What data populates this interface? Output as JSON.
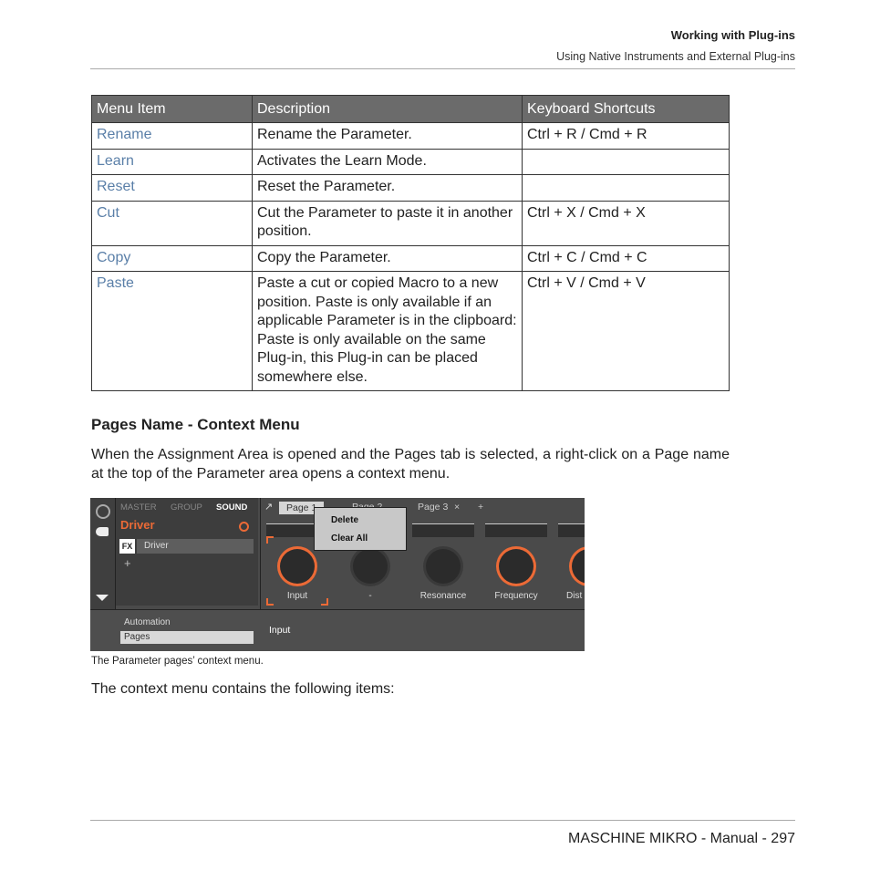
{
  "header": {
    "title": "Working with Plug-ins",
    "subtitle": "Using Native Instruments and External Plug-ins"
  },
  "table": {
    "headers": [
      "Menu Item",
      "Description",
      "Keyboard Shortcuts"
    ],
    "rows": [
      {
        "item": "Rename",
        "desc": "Rename the Parameter.",
        "shortcut": "Ctrl + R / Cmd + R"
      },
      {
        "item": "Learn",
        "desc": "Activates the Learn Mode.",
        "shortcut": ""
      },
      {
        "item": "Reset",
        "desc": "Reset the Parameter.",
        "shortcut": ""
      },
      {
        "item": "Cut",
        "desc": "Cut the Parameter to paste it in another position.",
        "shortcut": "Ctrl + X / Cmd + X"
      },
      {
        "item": "Copy",
        "desc": "Copy the Parameter.",
        "shortcut": "Ctrl + C / Cmd + C"
      },
      {
        "item": "Paste",
        "desc": "Paste a cut or copied Macro to a new position. Paste is only available if an applicable Parameter is in the clipboard: Paste is only available on the same Plug-in, this Plug-in can be placed somewhere else.",
        "shortcut": "Ctrl + V / Cmd + V"
      }
    ]
  },
  "section_title": "Pages Name - Context Menu",
  "intro": "When the Assignment Area is opened and the Pages tab is selected, a right-click on a Page name at the top of the Parameter area opens a context menu.",
  "screenshot": {
    "tabs": [
      "MASTER",
      "GROUP",
      "SOUND"
    ],
    "instrument": "Driver",
    "fx_label": "FX",
    "plugin": "Driver",
    "add": "+",
    "automation": "Automation",
    "pages": "Pages",
    "page_tabs": [
      "Page 1",
      "Page 2",
      "Page 3"
    ],
    "context_menu": [
      "Delete",
      "Clear All"
    ],
    "knobs": [
      "Input",
      "-",
      "Resonance",
      "Frequency",
      "Dist"
    ],
    "param_name": "Input"
  },
  "caption": "The Parameter pages’ context menu.",
  "outro": "The context menu contains the following items:",
  "footer": "MASCHINE MIKRO - Manual - 297"
}
